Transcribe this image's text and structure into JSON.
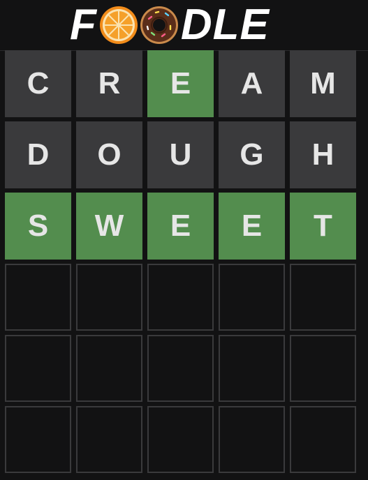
{
  "logo": {
    "prefix": "F",
    "suffix": "DLE",
    "icons": [
      "orange-slice-icon",
      "donut-icon"
    ]
  },
  "colors": {
    "background": "#121213",
    "absent": "#3a3a3c",
    "correct": "#538d4e",
    "empty_border": "#3a3a3c",
    "letter": "#e6e6e6"
  },
  "board": {
    "rows": [
      {
        "tiles": [
          {
            "letter": "C",
            "state": "absent"
          },
          {
            "letter": "R",
            "state": "absent"
          },
          {
            "letter": "E",
            "state": "correct"
          },
          {
            "letter": "A",
            "state": "absent"
          },
          {
            "letter": "M",
            "state": "absent"
          }
        ]
      },
      {
        "tiles": [
          {
            "letter": "D",
            "state": "absent"
          },
          {
            "letter": "O",
            "state": "absent"
          },
          {
            "letter": "U",
            "state": "absent"
          },
          {
            "letter": "G",
            "state": "absent"
          },
          {
            "letter": "H",
            "state": "absent"
          }
        ]
      },
      {
        "tiles": [
          {
            "letter": "S",
            "state": "correct"
          },
          {
            "letter": "W",
            "state": "correct"
          },
          {
            "letter": "E",
            "state": "correct"
          },
          {
            "letter": "E",
            "state": "correct"
          },
          {
            "letter": "T",
            "state": "correct"
          }
        ]
      },
      {
        "tiles": [
          {
            "letter": "",
            "state": "empty"
          },
          {
            "letter": "",
            "state": "empty"
          },
          {
            "letter": "",
            "state": "empty"
          },
          {
            "letter": "",
            "state": "empty"
          },
          {
            "letter": "",
            "state": "empty"
          }
        ]
      },
      {
        "tiles": [
          {
            "letter": "",
            "state": "empty"
          },
          {
            "letter": "",
            "state": "empty"
          },
          {
            "letter": "",
            "state": "empty"
          },
          {
            "letter": "",
            "state": "empty"
          },
          {
            "letter": "",
            "state": "empty"
          }
        ]
      },
      {
        "tiles": [
          {
            "letter": "",
            "state": "empty"
          },
          {
            "letter": "",
            "state": "empty"
          },
          {
            "letter": "",
            "state": "empty"
          },
          {
            "letter": "",
            "state": "empty"
          },
          {
            "letter": "",
            "state": "empty"
          }
        ]
      }
    ]
  }
}
